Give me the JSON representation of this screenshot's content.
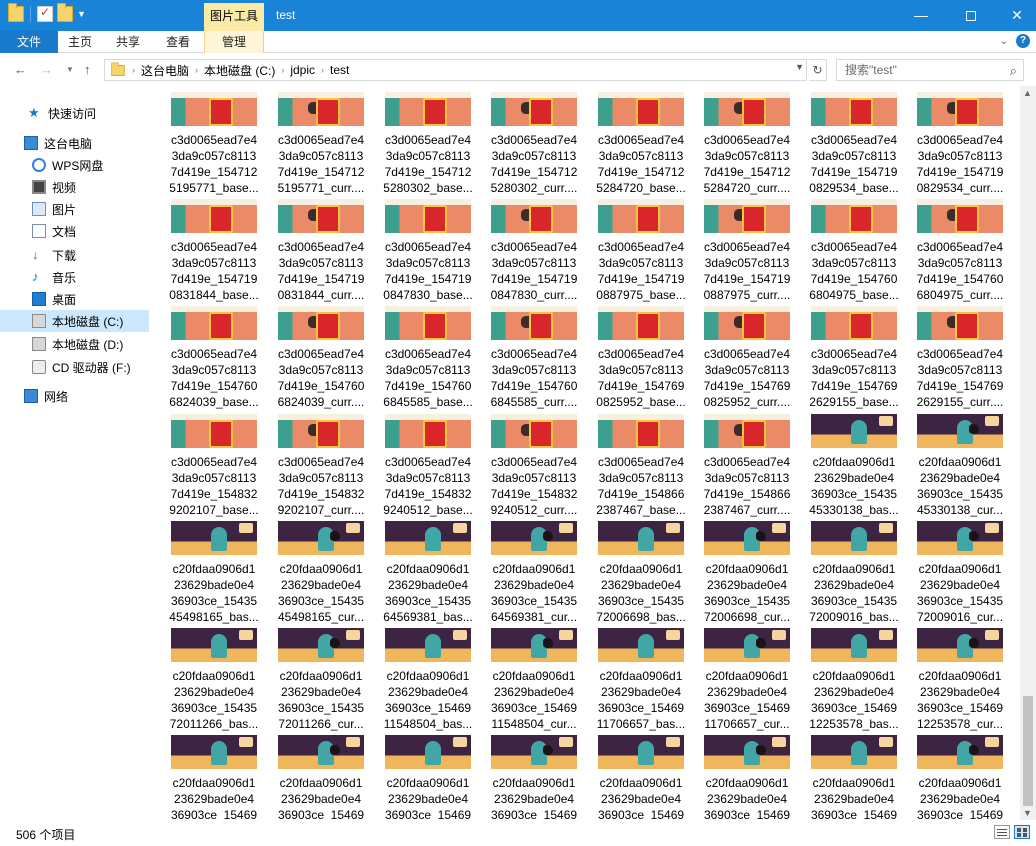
{
  "window": {
    "title": "test",
    "context_tab": "图片工具",
    "minimize": "—",
    "close": "✕"
  },
  "ribbon": {
    "file": "文件",
    "home": "主页",
    "share": "共享",
    "view": "查看",
    "manage": "管理"
  },
  "address": {
    "crumbs": [
      "这台电脑",
      "本地磁盘 (C:)",
      "jdpic",
      "test"
    ],
    "search_placeholder": "搜索\"test\""
  },
  "sidebar": {
    "items": [
      {
        "label": "快速访问",
        "icon": "star-icon"
      },
      {
        "label": "这台电脑",
        "icon": "computer-icon"
      },
      {
        "label": "WPS网盘",
        "icon": "cloud-icon"
      },
      {
        "label": "视频",
        "icon": "video-icon"
      },
      {
        "label": "图片",
        "icon": "pictures-icon"
      },
      {
        "label": "文档",
        "icon": "documents-icon"
      },
      {
        "label": "下载",
        "icon": "download-icon"
      },
      {
        "label": "音乐",
        "icon": "music-icon"
      },
      {
        "label": "桌面",
        "icon": "desktop-icon"
      },
      {
        "label": "本地磁盘 (C:)",
        "icon": "drive-icon",
        "selected": true
      },
      {
        "label": "本地磁盘 (D:)",
        "icon": "drive-icon"
      },
      {
        "label": "CD 驱动器 (F:)",
        "icon": "cd-drive-icon"
      },
      {
        "label": "网络",
        "icon": "network-icon"
      }
    ]
  },
  "files": [
    {
      "thumb": "a",
      "kind": "base",
      "lines": [
        "c3d0065ead7e4",
        "3da9c057c8113",
        "7d419e_154712",
        "5195771_base..."
      ]
    },
    {
      "thumb": "a",
      "kind": "curr",
      "lines": [
        "c3d0065ead7e4",
        "3da9c057c8113",
        "7d419e_154712",
        "5195771_curr...."
      ]
    },
    {
      "thumb": "a",
      "kind": "base",
      "lines": [
        "c3d0065ead7e4",
        "3da9c057c8113",
        "7d419e_154712",
        "5280302_base..."
      ]
    },
    {
      "thumb": "a",
      "kind": "curr",
      "lines": [
        "c3d0065ead7e4",
        "3da9c057c8113",
        "7d419e_154712",
        "5280302_curr...."
      ]
    },
    {
      "thumb": "a",
      "kind": "base",
      "lines": [
        "c3d0065ead7e4",
        "3da9c057c8113",
        "7d419e_154712",
        "5284720_base..."
      ]
    },
    {
      "thumb": "a",
      "kind": "curr",
      "lines": [
        "c3d0065ead7e4",
        "3da9c057c8113",
        "7d419e_154712",
        "5284720_curr...."
      ]
    },
    {
      "thumb": "a",
      "kind": "base",
      "lines": [
        "c3d0065ead7e4",
        "3da9c057c8113",
        "7d419e_154719",
        "0829534_base..."
      ]
    },
    {
      "thumb": "a",
      "kind": "curr",
      "lines": [
        "c3d0065ead7e4",
        "3da9c057c8113",
        "7d419e_154719",
        "0829534_curr...."
      ]
    },
    {
      "thumb": "a",
      "kind": "base",
      "lines": [
        "c3d0065ead7e4",
        "3da9c057c8113",
        "7d419e_154719",
        "0831844_base..."
      ]
    },
    {
      "thumb": "a",
      "kind": "curr",
      "lines": [
        "c3d0065ead7e4",
        "3da9c057c8113",
        "7d419e_154719",
        "0831844_curr...."
      ]
    },
    {
      "thumb": "a",
      "kind": "base",
      "lines": [
        "c3d0065ead7e4",
        "3da9c057c8113",
        "7d419e_154719",
        "0847830_base..."
      ]
    },
    {
      "thumb": "a",
      "kind": "curr",
      "lines": [
        "c3d0065ead7e4",
        "3da9c057c8113",
        "7d419e_154719",
        "0847830_curr...."
      ]
    },
    {
      "thumb": "a",
      "kind": "base",
      "lines": [
        "c3d0065ead7e4",
        "3da9c057c8113",
        "7d419e_154719",
        "0887975_base..."
      ]
    },
    {
      "thumb": "a",
      "kind": "curr",
      "lines": [
        "c3d0065ead7e4",
        "3da9c057c8113",
        "7d419e_154719",
        "0887975_curr...."
      ]
    },
    {
      "thumb": "a",
      "kind": "base",
      "lines": [
        "c3d0065ead7e4",
        "3da9c057c8113",
        "7d419e_154760",
        "6804975_base..."
      ]
    },
    {
      "thumb": "a",
      "kind": "curr",
      "lines": [
        "c3d0065ead7e4",
        "3da9c057c8113",
        "7d419e_154760",
        "6804975_curr...."
      ]
    },
    {
      "thumb": "a",
      "kind": "base",
      "lines": [
        "c3d0065ead7e4",
        "3da9c057c8113",
        "7d419e_154760",
        "6824039_base..."
      ]
    },
    {
      "thumb": "a",
      "kind": "curr",
      "lines": [
        "c3d0065ead7e4",
        "3da9c057c8113",
        "7d419e_154760",
        "6824039_curr...."
      ]
    },
    {
      "thumb": "a",
      "kind": "base",
      "lines": [
        "c3d0065ead7e4",
        "3da9c057c8113",
        "7d419e_154760",
        "6845585_base..."
      ]
    },
    {
      "thumb": "a",
      "kind": "curr",
      "lines": [
        "c3d0065ead7e4",
        "3da9c057c8113",
        "7d419e_154760",
        "6845585_curr...."
      ]
    },
    {
      "thumb": "a",
      "kind": "base",
      "lines": [
        "c3d0065ead7e4",
        "3da9c057c8113",
        "7d419e_154769",
        "0825952_base..."
      ]
    },
    {
      "thumb": "a",
      "kind": "curr",
      "lines": [
        "c3d0065ead7e4",
        "3da9c057c8113",
        "7d419e_154769",
        "0825952_curr...."
      ]
    },
    {
      "thumb": "a",
      "kind": "base",
      "lines": [
        "c3d0065ead7e4",
        "3da9c057c8113",
        "7d419e_154769",
        "2629155_base..."
      ]
    },
    {
      "thumb": "a",
      "kind": "curr",
      "lines": [
        "c3d0065ead7e4",
        "3da9c057c8113",
        "7d419e_154769",
        "2629155_curr...."
      ]
    },
    {
      "thumb": "a",
      "kind": "base",
      "lines": [
        "c3d0065ead7e4",
        "3da9c057c8113",
        "7d419e_154832",
        "9202107_base..."
      ]
    },
    {
      "thumb": "a",
      "kind": "curr",
      "lines": [
        "c3d0065ead7e4",
        "3da9c057c8113",
        "7d419e_154832",
        "9202107_curr...."
      ]
    },
    {
      "thumb": "a",
      "kind": "base",
      "lines": [
        "c3d0065ead7e4",
        "3da9c057c8113",
        "7d419e_154832",
        "9240512_base..."
      ]
    },
    {
      "thumb": "a",
      "kind": "curr",
      "lines": [
        "c3d0065ead7e4",
        "3da9c057c8113",
        "7d419e_154832",
        "9240512_curr...."
      ]
    },
    {
      "thumb": "a",
      "kind": "base",
      "lines": [
        "c3d0065ead7e4",
        "3da9c057c8113",
        "7d419e_154866",
        "2387467_base..."
      ]
    },
    {
      "thumb": "a",
      "kind": "curr",
      "lines": [
        "c3d0065ead7e4",
        "3da9c057c8113",
        "7d419e_154866",
        "2387467_curr...."
      ]
    },
    {
      "thumb": "b",
      "kind": "base",
      "lines": [
        "c20fdaa0906d1",
        "23629bade0e4",
        "36903ce_15435",
        "45330138_bas..."
      ]
    },
    {
      "thumb": "b",
      "kind": "curr",
      "lines": [
        "c20fdaa0906d1",
        "23629bade0e4",
        "36903ce_15435",
        "45330138_cur..."
      ]
    },
    {
      "thumb": "b",
      "kind": "base",
      "lines": [
        "c20fdaa0906d1",
        "23629bade0e4",
        "36903ce_15435",
        "45498165_bas..."
      ]
    },
    {
      "thumb": "b",
      "kind": "curr",
      "lines": [
        "c20fdaa0906d1",
        "23629bade0e4",
        "36903ce_15435",
        "45498165_cur..."
      ]
    },
    {
      "thumb": "b",
      "kind": "base",
      "lines": [
        "c20fdaa0906d1",
        "23629bade0e4",
        "36903ce_15435",
        "64569381_bas..."
      ]
    },
    {
      "thumb": "b",
      "kind": "curr",
      "lines": [
        "c20fdaa0906d1",
        "23629bade0e4",
        "36903ce_15435",
        "64569381_cur..."
      ]
    },
    {
      "thumb": "b",
      "kind": "base",
      "lines": [
        "c20fdaa0906d1",
        "23629bade0e4",
        "36903ce_15435",
        "72006698_bas..."
      ]
    },
    {
      "thumb": "b",
      "kind": "curr",
      "lines": [
        "c20fdaa0906d1",
        "23629bade0e4",
        "36903ce_15435",
        "72006698_cur..."
      ]
    },
    {
      "thumb": "b",
      "kind": "base",
      "lines": [
        "c20fdaa0906d1",
        "23629bade0e4",
        "36903ce_15435",
        "72009016_bas..."
      ]
    },
    {
      "thumb": "b",
      "kind": "curr",
      "lines": [
        "c20fdaa0906d1",
        "23629bade0e4",
        "36903ce_15435",
        "72009016_cur..."
      ]
    },
    {
      "thumb": "b",
      "kind": "base",
      "lines": [
        "c20fdaa0906d1",
        "23629bade0e4",
        "36903ce_15435",
        "72011266_bas..."
      ]
    },
    {
      "thumb": "b",
      "kind": "curr",
      "lines": [
        "c20fdaa0906d1",
        "23629bade0e4",
        "36903ce_15435",
        "72011266_cur..."
      ]
    },
    {
      "thumb": "b",
      "kind": "base",
      "lines": [
        "c20fdaa0906d1",
        "23629bade0e4",
        "36903ce_15469",
        "11548504_bas..."
      ]
    },
    {
      "thumb": "b",
      "kind": "curr",
      "lines": [
        "c20fdaa0906d1",
        "23629bade0e4",
        "36903ce_15469",
        "11548504_cur..."
      ]
    },
    {
      "thumb": "b",
      "kind": "base",
      "lines": [
        "c20fdaa0906d1",
        "23629bade0e4",
        "36903ce_15469",
        "11706657_bas..."
      ]
    },
    {
      "thumb": "b",
      "kind": "curr",
      "lines": [
        "c20fdaa0906d1",
        "23629bade0e4",
        "36903ce_15469",
        "11706657_cur..."
      ]
    },
    {
      "thumb": "b",
      "kind": "base",
      "lines": [
        "c20fdaa0906d1",
        "23629bade0e4",
        "36903ce_15469",
        "12253578_bas..."
      ]
    },
    {
      "thumb": "b",
      "kind": "curr",
      "lines": [
        "c20fdaa0906d1",
        "23629bade0e4",
        "36903ce_15469",
        "12253578_cur..."
      ]
    },
    {
      "thumb": "b",
      "kind": "base",
      "lines": [
        "c20fdaa0906d1",
        "23629bade0e4",
        "36903ce_15469",
        ""
      ]
    },
    {
      "thumb": "b",
      "kind": "curr",
      "lines": [
        "c20fdaa0906d1",
        "23629bade0e4",
        "36903ce_15469",
        ""
      ]
    },
    {
      "thumb": "b",
      "kind": "base",
      "lines": [
        "c20fdaa0906d1",
        "23629bade0e4",
        "36903ce_15469",
        ""
      ]
    },
    {
      "thumb": "b",
      "kind": "curr",
      "lines": [
        "c20fdaa0906d1",
        "23629bade0e4",
        "36903ce_15469",
        ""
      ]
    },
    {
      "thumb": "b",
      "kind": "base",
      "lines": [
        "c20fdaa0906d1",
        "23629bade0e4",
        "36903ce_15469",
        ""
      ]
    },
    {
      "thumb": "b",
      "kind": "curr",
      "lines": [
        "c20fdaa0906d1",
        "23629bade0e4",
        "36903ce_15469",
        ""
      ]
    },
    {
      "thumb": "b",
      "kind": "base",
      "lines": [
        "c20fdaa0906d1",
        "23629bade0e4",
        "36903ce_15469",
        ""
      ]
    },
    {
      "thumb": "b",
      "kind": "curr",
      "lines": [
        "c20fdaa0906d1",
        "23629bade0e4",
        "36903ce_15469",
        ""
      ]
    }
  ],
  "status": {
    "count": "506 个项目"
  },
  "colors": {
    "titlebar": "#1883d7",
    "file_tab": "#1979ca",
    "context_tab": "#fbe9a6",
    "selection": "#cce8ff"
  }
}
